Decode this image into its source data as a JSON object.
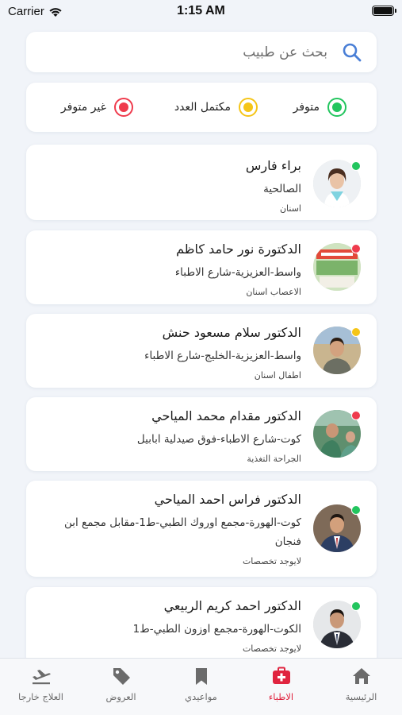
{
  "status_bar": {
    "carrier": "Carrier",
    "time": "1:15 AM"
  },
  "search": {
    "placeholder": "بحث عن طبيب",
    "value": ""
  },
  "legend": [
    {
      "label": "متوفر",
      "color": "#22c55e"
    },
    {
      "label": "مكتمل العدد",
      "color": "#f5c518"
    },
    {
      "label": "غير متوفر",
      "color": "#ef3b4d"
    }
  ],
  "doctors": [
    {
      "name": "براء فارس",
      "address": "الصالحية",
      "specialty": "اسنان",
      "status": "available"
    },
    {
      "name": "الدكتورة نور حامد كاظم",
      "address": "واسط-العزيزية-شارع الاطباء",
      "specialty": "الاعصاب اسنان",
      "status": "unavailable"
    },
    {
      "name": "الدكتور سلام مسعود حنش",
      "address": "واسط-العزيزية-الخليج-شارع الاطباء",
      "specialty": "اطفال اسنان",
      "status": "full"
    },
    {
      "name": "الدكتور مقدام محمد المياحي",
      "address": "كوت-شارع الاطباء-فوق صيدلية ابابيل",
      "specialty": "الجراحة التغذية",
      "status": "unavailable"
    },
    {
      "name": "الدكتور فراس احمد المياحي",
      "address": "كوت-الهورة-مجمع اوروك الطبي-ط1-مقابل مجمع ابن فنجان",
      "specialty": "لايوجد تخصصات",
      "status": "available"
    },
    {
      "name": "الدكتور احمد كريم الربيعي",
      "address": "الكوت-الهورة-مجمع اوزون الطبي-ط1",
      "specialty": "لايوجد تخصصات",
      "status": "available"
    }
  ],
  "tabs": [
    {
      "label": "الرئيسية",
      "icon": "home-icon",
      "active": false
    },
    {
      "label": "الاطباء",
      "icon": "medical-kit-icon",
      "active": true
    },
    {
      "label": "مواعيدي",
      "icon": "bookmark-icon",
      "active": false
    },
    {
      "label": "العروض",
      "icon": "tag-icon",
      "active": false
    },
    {
      "label": "العلاج خارجا",
      "icon": "plane-icon",
      "active": false
    }
  ],
  "colors": {
    "accent": "#e0243f",
    "search_icon": "#4a7fd6",
    "available": "#22c55e",
    "full": "#f5c518",
    "unavailable": "#ef3b4d"
  }
}
